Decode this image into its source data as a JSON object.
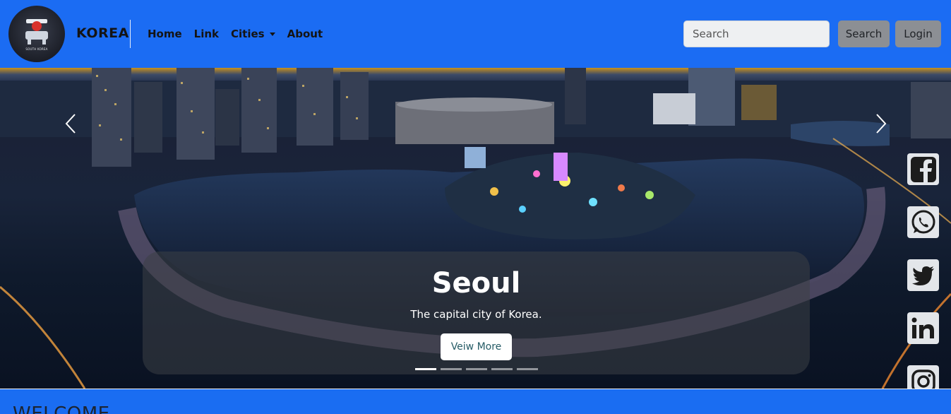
{
  "brand": {
    "name": "KOREA",
    "logo_text": "SOUTH KOREA"
  },
  "nav": {
    "items": [
      {
        "label": "Home"
      },
      {
        "label": "Link"
      },
      {
        "label": "Cities"
      },
      {
        "label": "About"
      }
    ],
    "dropdown_item": "Cities"
  },
  "search": {
    "placeholder": "Search",
    "button_label": "Search"
  },
  "login": {
    "label": "Login"
  },
  "carousel": {
    "title": "Seoul",
    "subtitle": "The capital city of Korea.",
    "button_label": "Veiw More",
    "slide_count": 5,
    "active_slide": 1,
    "prev_icon": "chevron-left-icon",
    "next_icon": "chevron-right-icon"
  },
  "social": [
    {
      "icon": "facebook-icon"
    },
    {
      "icon": "whatsapp-icon"
    },
    {
      "icon": "twitter-icon"
    },
    {
      "icon": "linkedin-icon"
    },
    {
      "icon": "instagram-icon"
    }
  ],
  "welcome": {
    "title": "WELCOME"
  },
  "colors": {
    "navbar": "#1b6cf3",
    "button_grey": "#8c8f94",
    "caption_bg": "rgba(60,64,70,0.55)"
  }
}
